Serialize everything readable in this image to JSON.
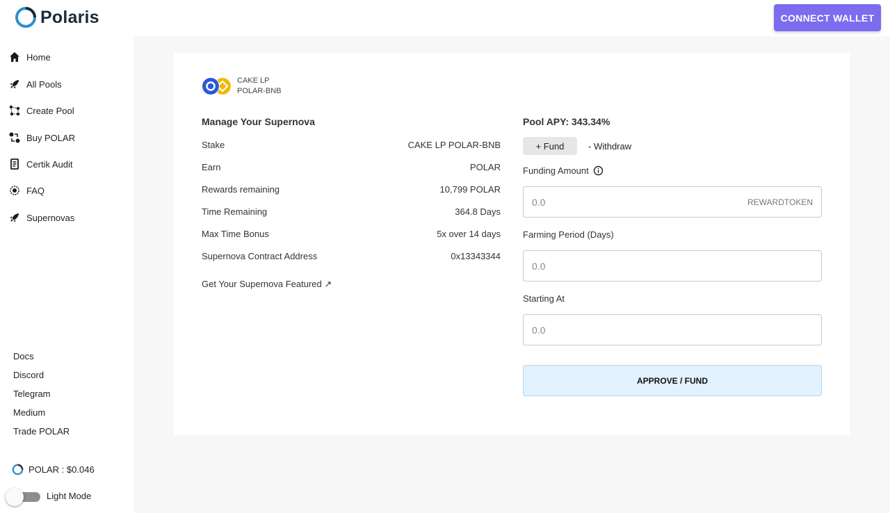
{
  "app": {
    "name": "Polaris",
    "connect_label": "CONNECT WALLET",
    "accent": "#7b6cf0"
  },
  "sidebar": {
    "nav": [
      {
        "label": "Home",
        "icon": "home-icon"
      },
      {
        "label": "All Pools",
        "icon": "rocket-icon"
      },
      {
        "label": "Create Pool",
        "icon": "network-icon"
      },
      {
        "label": "Buy POLAR",
        "icon": "swap-icon"
      },
      {
        "label": "Certik Audit",
        "icon": "document-icon"
      },
      {
        "label": "FAQ",
        "icon": "help-icon"
      },
      {
        "label": "Supernovas",
        "icon": "rocket-icon"
      }
    ],
    "links": [
      "Docs",
      "Discord",
      "Telegram",
      "Medium",
      "Trade POLAR"
    ],
    "price": "POLAR : $0.046",
    "theme_toggle": "Light Mode"
  },
  "pool": {
    "pair_line1": "CAKE LP",
    "pair_line2": "POLAR-BNB",
    "manage_title": "Manage Your Supernova",
    "rows": [
      {
        "label": "Stake",
        "value": "CAKE LP POLAR-BNB"
      },
      {
        "label": "Earn",
        "value": "POLAR"
      },
      {
        "label": "Rewards remaining",
        "value": "10,799 POLAR"
      },
      {
        "label": "Time Remaining",
        "value": "364.8 Days"
      },
      {
        "label": "Max Time Bonus",
        "value": "5x over 14 days"
      },
      {
        "label": "Supernova Contract Address",
        "value": "0x13343344"
      }
    ],
    "featured_link": "Get Your Supernova Featured ↗"
  },
  "fund": {
    "apy": "Pool APY: 343.34%",
    "tab_fund": "+  Fund",
    "tab_withdraw": "-  Withdraw",
    "funding_label": "Funding Amount",
    "funding_placeholder": "0.0",
    "funding_suffix": "REWARDTOKEN",
    "period_label": "Farming Period (Days)",
    "period_placeholder": "0.0",
    "start_label": "Starting At",
    "start_placeholder": "0.0",
    "approve_label": "APPROVE / FUND"
  }
}
